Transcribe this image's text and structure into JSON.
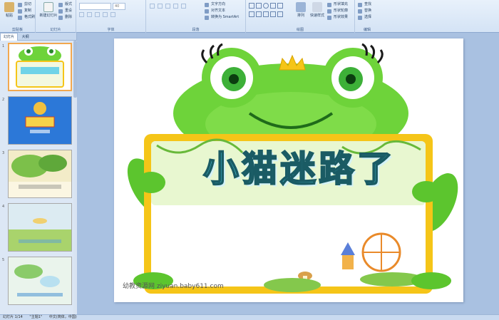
{
  "ribbon": {
    "clipboard": {
      "paste": "粘贴",
      "cut": "剪切",
      "copy": "复制",
      "format_painter": "格式刷",
      "title": "剪贴板"
    },
    "slides": {
      "new_slide": "新建幻灯片",
      "layout": "版式",
      "reset": "重设",
      "delete": "删除",
      "title": "幻灯片"
    },
    "font": {
      "size": "40",
      "title": "字体"
    },
    "paragraph": {
      "text_direction": "文字方向",
      "align_text": "对齐文本",
      "smartart": "转换为 SmartArt",
      "title": "段落"
    },
    "drawing": {
      "arrange": "排列",
      "quick_styles": "快速样式",
      "shape_fill": "形状填充",
      "shape_outline": "形状轮廓",
      "shape_effects": "形状效果",
      "title": "绘图"
    },
    "editing": {
      "find": "查找",
      "replace": "替换",
      "select": "选择",
      "title": "编辑"
    }
  },
  "panel": {
    "tab_slides": "幻灯片",
    "tab_outline": "大纲",
    "thumbnails": [
      {
        "num": "1"
      },
      {
        "num": "2"
      },
      {
        "num": "3"
      },
      {
        "num": "4"
      },
      {
        "num": "5"
      }
    ]
  },
  "slide": {
    "title": "小猫迷路了",
    "watermark": "幼教资源网 ziyuan.baby611.com"
  },
  "status": {
    "slide_count": "幻灯片 1/14",
    "theme": "\"主题1\"",
    "language": "中文(简体，中国)"
  }
}
